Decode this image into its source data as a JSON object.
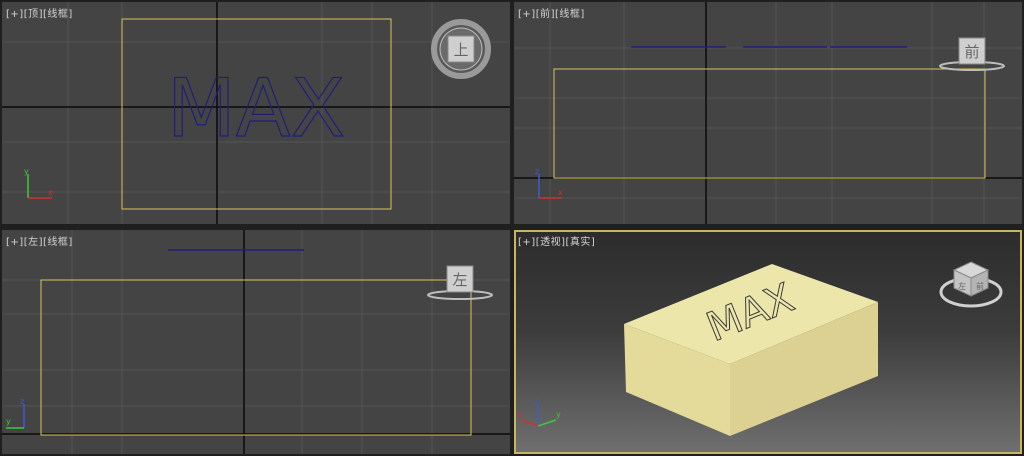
{
  "viewports": {
    "top": {
      "plus": "[+]",
      "view": "[顶]",
      "shading": "[线框]",
      "cube_face": "上"
    },
    "front": {
      "plus": "[+]",
      "view": "[前]",
      "shading": "[线框]",
      "cube_face": "前"
    },
    "left": {
      "plus": "[+]",
      "view": "[左]",
      "shading": "[线框]",
      "cube_face": "左"
    },
    "perspective": {
      "plus": "[+]",
      "view": "[透视]",
      "shading": "[真实]",
      "cube_face_top": "上",
      "cube_face_left": "左",
      "cube_face_front": "前"
    }
  },
  "scene": {
    "text_object": "MAX",
    "colors": {
      "viewport_bg": "#444444",
      "grid": "#555555",
      "grid_axis": "#0a0a0a",
      "box_wire": "#d8c45a",
      "text_wire": "#1e1e7a",
      "box_top": "#ece6aa",
      "box_side": "#dcd192",
      "box_front": "#e4da9a",
      "active_border": "#c8b65c",
      "axis_x": "#d23030",
      "axis_y": "#3cc83c",
      "axis_z": "#3c5cd2"
    }
  },
  "axis_labels": {
    "x": "x",
    "y": "y",
    "z": "z"
  }
}
